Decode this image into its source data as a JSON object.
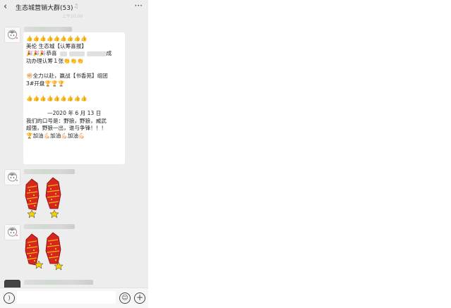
{
  "header": {
    "back_icon": "chevron-left-icon",
    "title": "生态城营销大群(53)",
    "muted_icon": "bell-off-icon",
    "more_icon": "more-dots-icon"
  },
  "timestamp": "上午10:00",
  "messages": [
    {
      "type": "text",
      "lines": [
        "👍👍👍👍👍👍👍👍👍",
        "美伦 生态城【认筹喜报】",
        "🎉🎉🎉恭喜",
        "功办理认筹１张👏👏👏",
        "",
        "✊🏻全力以赴，赢战【书香苑】组团",
        "3#开盘🏆🏆🏆",
        "",
        "👍👍👍👍👍👍👍👍👍",
        "",
        "—2020 年 6 月 13 日",
        "我们的口号是：野狼，野狼，威武",
        "超强，野狼一出，谁与争锋！！！",
        "🏆加油💪🏻加油💪🏻加油💪🏻"
      ],
      "line3_suffix": "成"
    },
    {
      "type": "sticker",
      "icon": "firecracker-sticker-icon"
    },
    {
      "type": "sticker",
      "icon": "firecracker-sticker-icon"
    }
  ],
  "input_bar": {
    "voice_icon": "voice-icon",
    "emoji_icon": "emoji-icon",
    "plus_icon": "plus-icon"
  },
  "colors": {
    "background": "#ededed",
    "bubble": "#ffffff"
  }
}
